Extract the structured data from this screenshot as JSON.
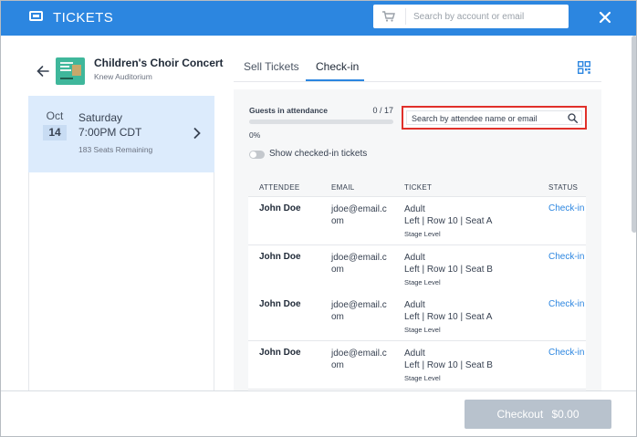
{
  "header": {
    "title": "TICKETS",
    "search_placeholder": "Search by account or email",
    "accent_color": "#2c86e0",
    "icons": [
      "ticket-icon",
      "cart-icon",
      "close-icon"
    ]
  },
  "event": {
    "title": "Children's Choir Concert",
    "venue": "Knew Auditorium"
  },
  "date_card": {
    "month": "Oct",
    "day": "14",
    "weekday": "Saturday",
    "time": "7:00PM CDT",
    "seats": "183 Seats Remaining"
  },
  "tabs": [
    {
      "label": "Sell Tickets",
      "active": false
    },
    {
      "label": "Check-in",
      "active": true
    }
  ],
  "checkin": {
    "guests_label": "Guests in attendance",
    "guests_count": "0 / 17",
    "progress_fraction": 0,
    "progress_percent": "0%",
    "toggle_label": "Show checked-in tickets",
    "toggle_on": false,
    "search_placeholder": "Search by attendee name or email"
  },
  "table": {
    "columns": [
      "ATTENDEE",
      "EMAIL",
      "TICKET",
      "STATUS"
    ],
    "rows": [
      {
        "attendee": "John Doe",
        "email": "jdoe@email.com",
        "ticket": "Adult",
        "seat": "Left | Row 10 | Seat A",
        "level": "Stage Level",
        "status": "Check-in"
      },
      {
        "attendee": "John Doe",
        "email": "jdoe@email.com",
        "ticket": "Adult",
        "seat": "Left | Row 10 | Seat B",
        "level": "Stage Level",
        "status": "Check-in"
      },
      {
        "attendee": "John Doe",
        "email": "jdoe@email.com",
        "ticket": "Adult",
        "seat": "Left | Row 10 | Seat A",
        "level": "Stage Level",
        "status": "Check-in"
      },
      {
        "attendee": "John Doe",
        "email": "jdoe@email.com",
        "ticket": "Adult",
        "seat": "Left | Row 10 | Seat B",
        "level": "Stage Level",
        "status": "Check-in"
      }
    ]
  },
  "footer": {
    "checkout_label": "Checkout",
    "checkout_total": "$0.00"
  }
}
